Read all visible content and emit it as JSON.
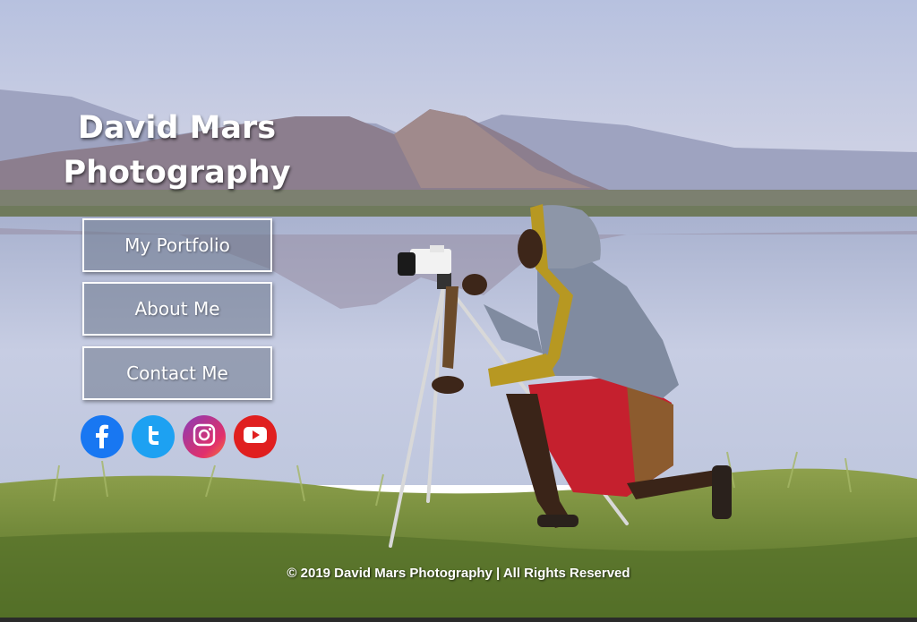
{
  "header": {
    "title_line1": "David Mars",
    "title_line2": "Photography"
  },
  "nav": {
    "portfolio_label": "My Portfolio",
    "about_label": "About Me",
    "contact_label": "Contact Me"
  },
  "social": [
    {
      "icon": "facebook-icon",
      "color": "#1877f2"
    },
    {
      "icon": "twitter-icon",
      "color": "#1da1f2"
    },
    {
      "icon": "instagram-icon",
      "color": "#c13584"
    },
    {
      "icon": "youtube-icon",
      "color": "#e01f1f"
    }
  ],
  "footer": {
    "text": "© 2019 David Mars Photography | All Rights Reserved"
  }
}
